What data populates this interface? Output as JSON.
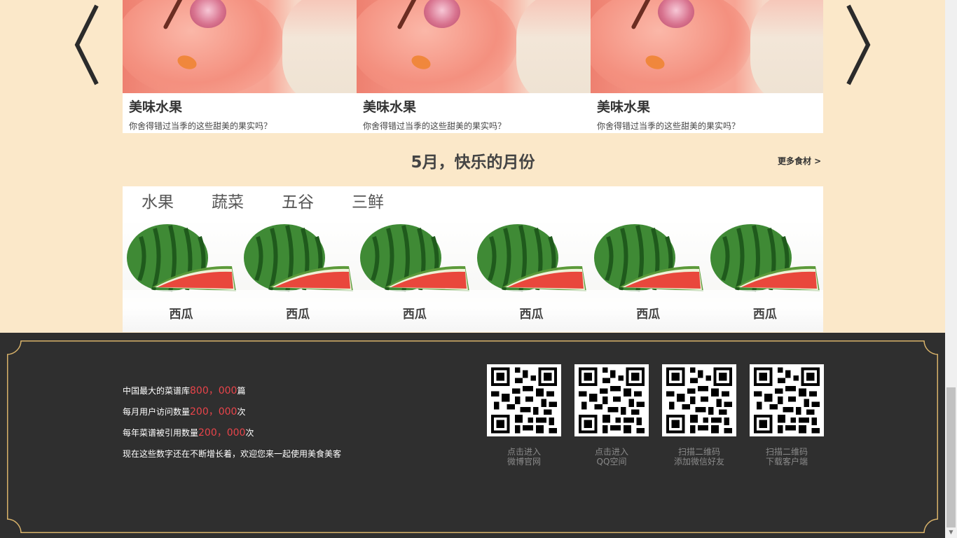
{
  "carousel": {
    "prev_icon": "left-chevron-icon",
    "next_icon": "right-chevron-icon",
    "cards": [
      {
        "title": "美味水果",
        "desc": "你舍得错过当季的这些甜美的果实吗？"
      },
      {
        "title": "美味水果",
        "desc": "你舍得错过当季的这些甜美的果实吗？"
      },
      {
        "title": "美味水果",
        "desc": "你舍得错过当季的这些甜美的果实吗？"
      }
    ]
  },
  "month_section": {
    "title": "5月，快乐的月份",
    "more_link": "更多食材  >"
  },
  "ingredients": {
    "tabs": [
      "水果",
      "蔬菜",
      "五谷",
      "三鲜"
    ],
    "items": [
      {
        "label": "西瓜"
      },
      {
        "label": "西瓜"
      },
      {
        "label": "西瓜"
      },
      {
        "label": "西瓜"
      },
      {
        "label": "西瓜"
      },
      {
        "label": "西瓜"
      }
    ]
  },
  "footer": {
    "stats": [
      {
        "prefix": "中国最大的菜谱库",
        "number": "800，000",
        "suffix": "篇"
      },
      {
        "prefix": "每月用户访问数量",
        "number": "200，000",
        "suffix": "次"
      },
      {
        "prefix": "每年菜谱被引用数量",
        "number": "200，000",
        "suffix": "次"
      }
    ],
    "tagline": "现在这些数字还在不断增长着，欢迎您来一起使用美食美客",
    "qr_codes": [
      {
        "line1": "点击进入",
        "line2": "微博官网"
      },
      {
        "line1": "点击进入",
        "line2": "QQ空间"
      },
      {
        "line1": "扫描二维码",
        "line2": "添加微信好友"
      },
      {
        "line1": "扫描二维码",
        "line2": "下载客户端"
      }
    ]
  },
  "colors": {
    "page_bg": "#fbe8c9",
    "footer_bg": "#2f2f2f",
    "frame_gold": "#d9b36a",
    "stat_number": "#e8444a"
  }
}
